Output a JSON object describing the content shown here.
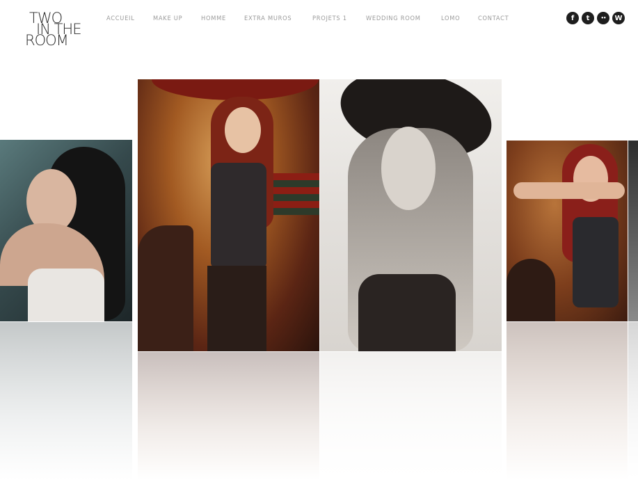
{
  "logo": {
    "line1": "TWO",
    "line2": "IN THE",
    "line3": "ROOM"
  },
  "nav": {
    "items": [
      {
        "label": "ACCUEIL"
      },
      {
        "label": "MAKE UP"
      },
      {
        "label": "HOMME"
      },
      {
        "label": "EXTRA MUROS"
      },
      {
        "label": "PROJETS 1"
      },
      {
        "label": "WEDDING ROOM"
      },
      {
        "label": "LOMO"
      },
      {
        "label": "CONTACT"
      }
    ]
  },
  "social": {
    "icons": [
      {
        "name": "facebook-icon",
        "glyph": "f"
      },
      {
        "name": "twitter-icon",
        "glyph": "t"
      },
      {
        "name": "flickr-icon",
        "glyph": "••"
      },
      {
        "name": "wordpress-icon",
        "glyph": "W"
      }
    ]
  },
  "gallery": {
    "photos": [
      {
        "subject": "woman-dark-hair-white-top"
      },
      {
        "subject": "woman-red-hair-antlers-drums"
      },
      {
        "subject": "woman-black-hat-monochrome"
      },
      {
        "subject": "woman-red-hair-laughing"
      },
      {
        "subject": "partial-photo-edge"
      }
    ]
  }
}
